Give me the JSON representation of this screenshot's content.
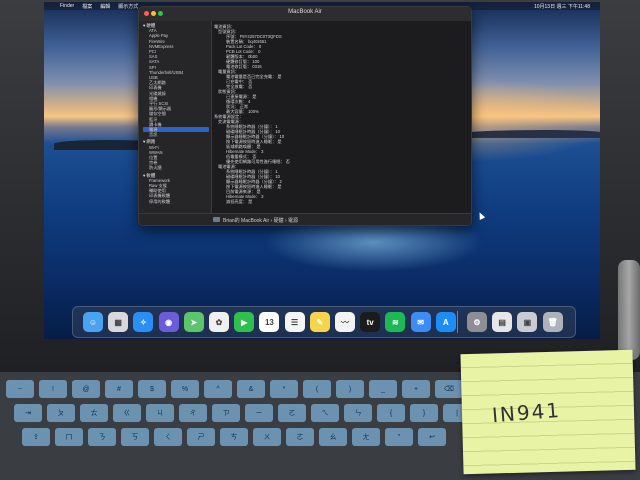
{
  "menubar": {
    "items": [
      "",
      "Finder",
      "檔案",
      "編輯",
      "顯示方式"
    ],
    "clock": "10月13日 週三 下午11:48"
  },
  "window": {
    "title": "MacBook Air",
    "sidebar": {
      "hardware_header": "▾ 硬體",
      "hardware_items": [
        "ATA",
        "Apple Pay",
        "FireWire",
        "NVMExpress",
        "PCI",
        "SAS",
        "SATA",
        "SPI",
        "Thunderbolt/USB4",
        "USB",
        "乙太網路",
        "印表機",
        "光碟燒錄",
        "相機",
        "平行 SCSI",
        "圖形/顯示器",
        "儲存空間",
        "藍牙",
        "讀卡機",
        "電源",
        "音訊"
      ],
      "network_header": "▾ 網路",
      "network_items": [
        "Wi-Fi",
        "WWAN",
        "位置",
        "宗卷",
        "防火牆"
      ],
      "software_header": "▾ 軟體",
      "software_items": [
        "Framework",
        "Raw 支援",
        "輔助使用",
        "印表機軟體",
        "停用的軟體"
      ],
      "selected": "電源"
    },
    "content": {
      "lines": [
        "電池資訊：",
        "型號資訊：",
        "序號：  F8Y4257DC0T3QFDS",
        "裝置名稱：  bq40z651",
        "Pack Lot Code：  0",
        "PCB Lot Code：  0",
        "韌體版本：  0b00",
        "硬體修訂版：  100",
        "電池修訂版：  0316",
        "電量資訊：",
        "電池電量是否已完全充電：  是",
        "已充電中：  否",
        "完全放電：  否",
        "狀態資訊：",
        "已連接電源：  是",
        "循環次數：  4",
        "狀況：  正常",
        "最大容量：  100%",
        "系統電源設定：",
        "交流電電源：",
        "系統睡眠計時器（分鐘）：  1",
        "磁碟睡眠計時器（分鐘）：  10",
        "顯示器睡眠計時器（分鐘）：  10",
        "按下電源按鈕時進入睡眠：  是",
        "區域網路喚醒：  是",
        "Hibernate Mode：  3",
        "低電量模式：  否",
        "優先使用網路可用性進行睡眠：  否",
        "電池電源：",
        "系統睡眠計時器（分鐘）：  1",
        "磁碟睡眠計時器（分鐘）：  10",
        "顯示器睡眠計時器（分鐘）：  2",
        "按下電源按鈕時進入睡眠：  是",
        "目前電源來源：  是",
        "Hibernate Mode：  3",
        "減低亮度：  是"
      ]
    },
    "breadcrumb": "Brian的 MacBook Air › 硬體 › 電源"
  },
  "dock": {
    "apps": [
      {
        "name": "Finder",
        "glyph": "☺",
        "color": "#4aa3f0"
      },
      {
        "name": "Launchpad",
        "glyph": "▦",
        "color": "#d7d7dc"
      },
      {
        "name": "Safari",
        "glyph": "✧",
        "color": "#2a8ef5"
      },
      {
        "name": "Siri",
        "glyph": "◉",
        "color": "#6d5cd9"
      },
      {
        "name": "Maps",
        "glyph": "➤",
        "color": "#5cc46b"
      },
      {
        "name": "Photos",
        "glyph": "✿",
        "color": "#f0f0f0"
      },
      {
        "name": "FaceTime",
        "glyph": "▶",
        "color": "#2fbf4f"
      },
      {
        "name": "Calendar",
        "glyph": "13",
        "color": "#ffffff"
      },
      {
        "name": "Reminders",
        "glyph": "☰",
        "color": "#f5f5f5"
      },
      {
        "name": "Notes",
        "glyph": "✎",
        "color": "#f7d54a"
      },
      {
        "name": "Freeform",
        "glyph": "〰",
        "color": "#f3f3f3"
      },
      {
        "name": "Apple TV",
        "glyph": "tv",
        "color": "#1b1b1b"
      },
      {
        "name": "Spotify",
        "glyph": "≋",
        "color": "#1db954"
      },
      {
        "name": "Mail",
        "glyph": "✉",
        "color": "#3d8cf6"
      },
      {
        "name": "App Store",
        "glyph": "A",
        "color": "#1c8ef3"
      },
      {
        "name": "System Preferences",
        "glyph": "⚙",
        "color": "#8e8e93"
      },
      {
        "name": "Preview",
        "glyph": "▤",
        "color": "#e6e6ea"
      },
      {
        "name": "System Information",
        "glyph": "▣",
        "color": "#c9cdd3"
      },
      {
        "name": "Trash",
        "glyph": "🗑",
        "color": "#aeb3bb"
      }
    ]
  },
  "keyboard": {
    "rows": [
      [
        "~",
        "!",
        "@",
        "#",
        "$",
        "%",
        "^",
        "&",
        "*",
        "(",
        ")",
        "_",
        "+",
        "⌫"
      ],
      [
        "⇥",
        "ㄆ",
        "ㄊ",
        "ㄍ",
        "ㄐ",
        "ㄔ",
        "ㄗ",
        "ㄧ",
        "ㄛ",
        "ㄟ",
        "ㄣ",
        "{",
        "}",
        "|"
      ],
      [
        "⇪",
        "ㄇ",
        "ㄋ",
        "ㄎ",
        "ㄑ",
        "ㄕ",
        "ㄘ",
        "ㄨ",
        "ㄜ",
        "ㄠ",
        "ㄤ",
        "\"",
        "↩"
      ]
    ]
  },
  "sticky_note": {
    "text": "IN941"
  }
}
